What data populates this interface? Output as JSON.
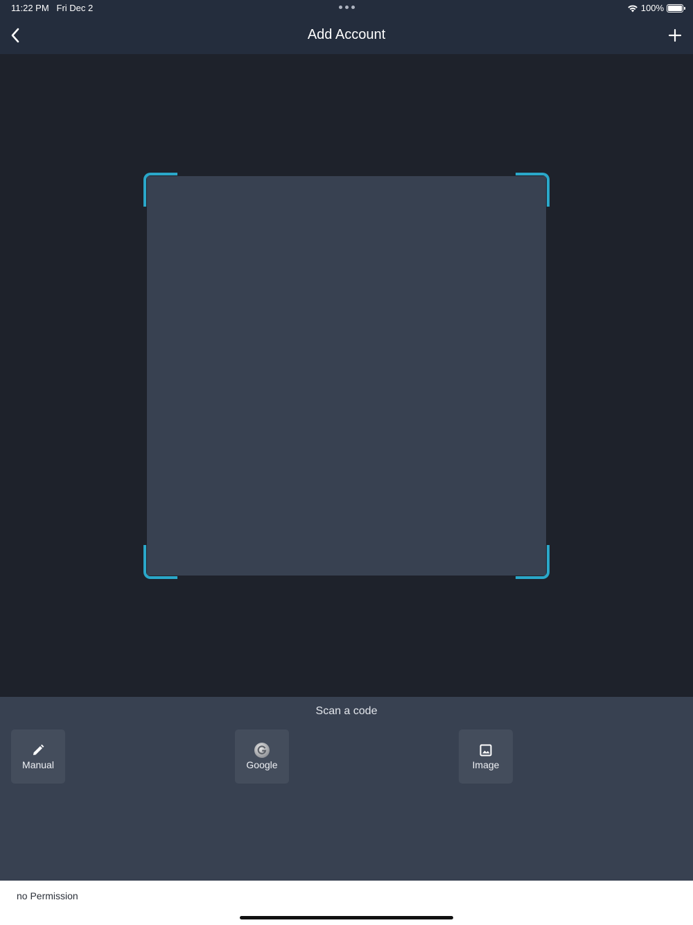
{
  "status_bar": {
    "time": "11:22 PM   Fri Dec 2",
    "battery": "100%"
  },
  "nav": {
    "title": "Add Account",
    "back_icon": "chevron-left-icon",
    "add_icon": "plus-icon"
  },
  "colors": {
    "accent": "#2aa7c9",
    "nav_bg": "#242d3d",
    "panel_bg": "#384151",
    "camera_bg": "#1e222b"
  },
  "scanner": {
    "label": "Scan a code"
  },
  "options": [
    {
      "label": "Manual",
      "icon": "pencil-icon"
    },
    {
      "label": "Google",
      "icon": "google-icon"
    },
    {
      "label": "Image",
      "icon": "image-icon"
    }
  ],
  "toast": {
    "message": "no Permission"
  }
}
